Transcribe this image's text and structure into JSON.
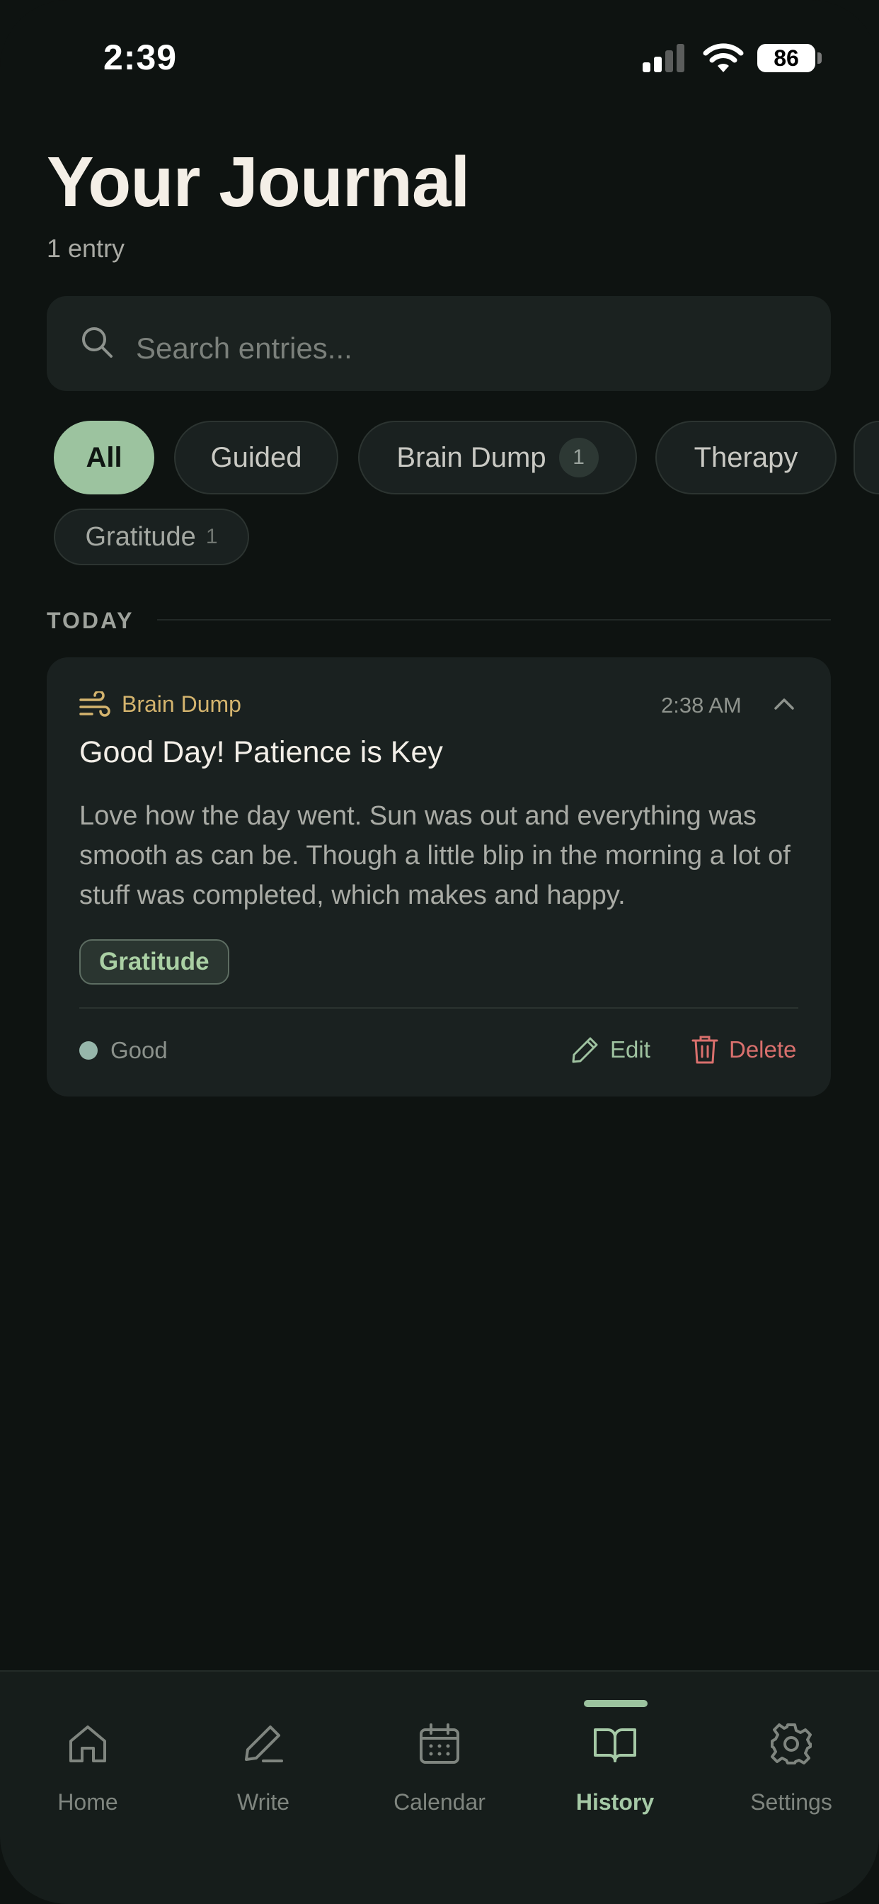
{
  "status_bar": {
    "time": "2:39",
    "battery": "86"
  },
  "header": {
    "title": "Your Journal",
    "entry_count": "1 entry"
  },
  "search": {
    "placeholder": "Search entries..."
  },
  "filters": {
    "all": "All",
    "guided": "Guided",
    "brain_dump": "Brain Dump",
    "brain_dump_count": "1",
    "therapy": "Therapy",
    "gratitude": "Gratitude",
    "gratitude_count": "1"
  },
  "section": {
    "today": "TODAY"
  },
  "entry": {
    "type": "Brain Dump",
    "time": "2:38 AM",
    "title": "Good Day! Patience is Key",
    "body": "Love how the day went. Sun was out and everything was smooth as can be. Though a little blip in the morning a lot of stuff was completed, which makes and happy.",
    "tag": "Gratitude",
    "mood": "Good",
    "edit_label": "Edit",
    "delete_label": "Delete"
  },
  "nav": {
    "home": "Home",
    "write": "Write",
    "calendar": "Calendar",
    "history": "History",
    "settings": "Settings"
  },
  "colors": {
    "background": "#0e1311",
    "card": "#1a2120",
    "accent_green": "#9cc39f",
    "brain_dump_gold": "#d4b46e",
    "delete_red": "#d9706d"
  },
  "icons": {
    "search": "search-icon",
    "brain_dump": "wind-icon",
    "collapse": "chevron-up-icon",
    "edit": "pencil-icon",
    "delete": "trash-icon",
    "home": "home-icon",
    "write": "pen-icon",
    "calendar": "calendar-icon",
    "history": "book-icon",
    "settings": "gear-icon"
  }
}
